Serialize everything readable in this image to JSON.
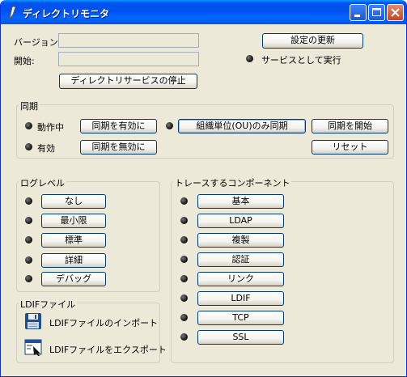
{
  "window": {
    "title": "ディレクトリモニタ"
  },
  "top": {
    "version_label": "バージョン:",
    "version_value": "",
    "start_label": "開始:",
    "start_value": "",
    "stop_service_button": "ディレクトリサービスの停止",
    "update_settings_button": "設定の更新",
    "run_as_service_label": "サービスとして実行"
  },
  "sync": {
    "legend": "同期",
    "running_label": "動作中",
    "enabled_label": "有効",
    "enable_button": "同期を有効に",
    "disable_button": "同期を無効に",
    "ou_sync_button": "組織単位(OU)のみ同期",
    "start_button": "同期を開始",
    "reset_button": "リセット"
  },
  "log_level": {
    "legend": "ログレベル",
    "items": [
      "なし",
      "最小限",
      "標準",
      "詳細",
      "デバッグ"
    ]
  },
  "trace": {
    "legend": "トレースするコンポーネント",
    "items": [
      "基本",
      "LDAP",
      "複製",
      "認証",
      "リンク",
      "LDIF",
      "TCP",
      "SSL"
    ]
  },
  "ldif": {
    "legend": "LDIFファイル",
    "import_label": "LDIFファイルのインポート",
    "export_label": "LDIFファイルをエクスポート"
  }
}
